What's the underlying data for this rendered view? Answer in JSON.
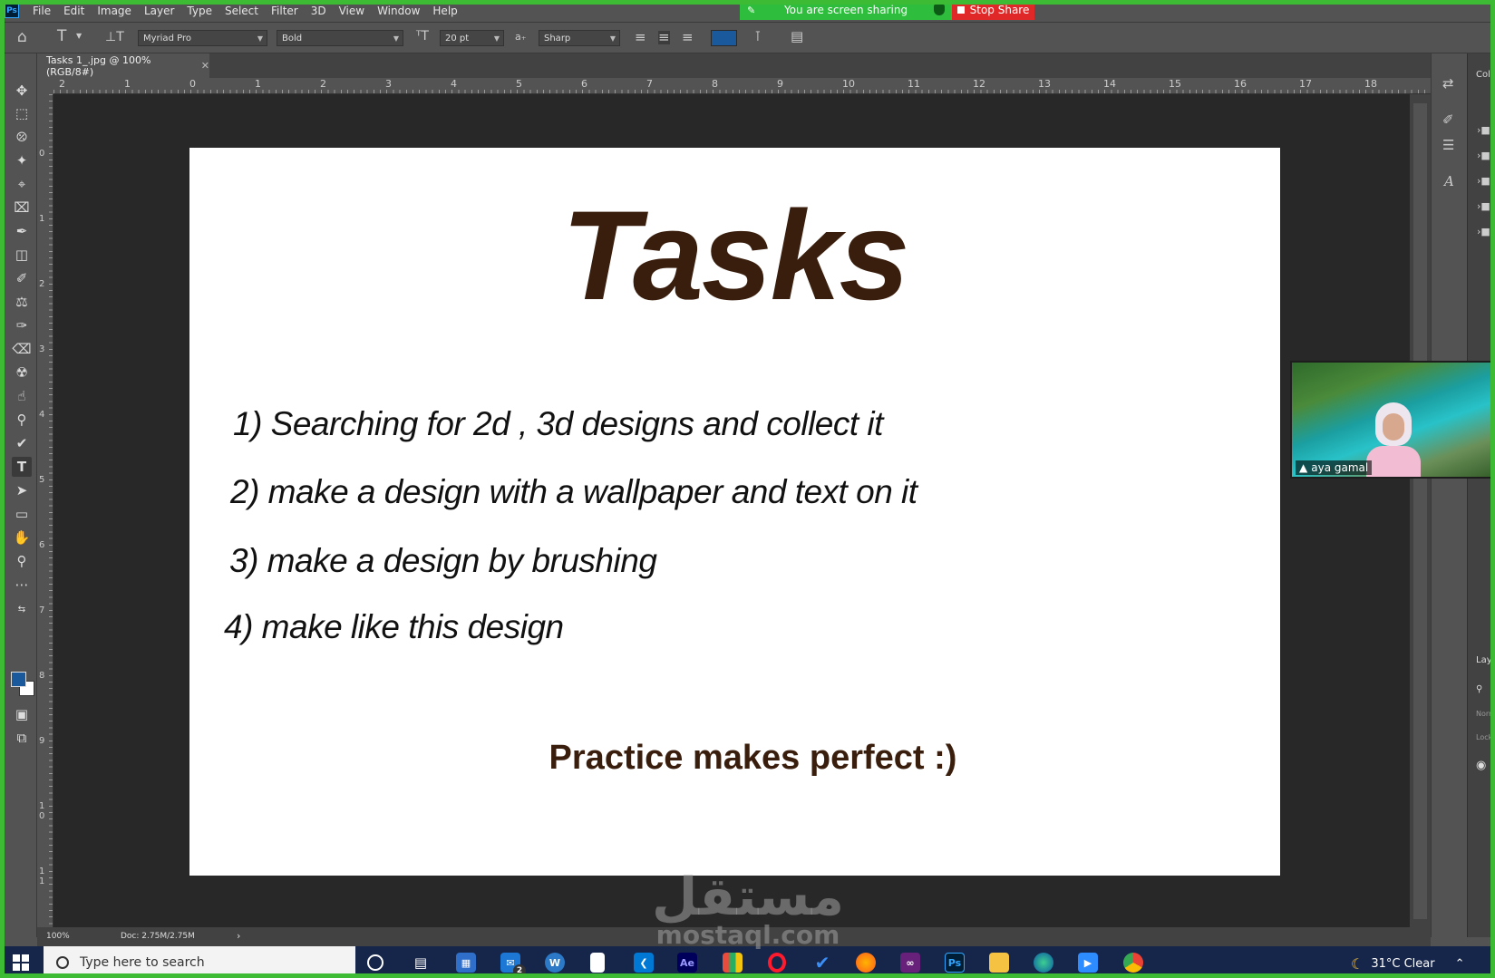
{
  "app": {
    "logo": "Ps"
  },
  "menu": [
    "File",
    "Edit",
    "Image",
    "Layer",
    "Type",
    "Select",
    "Filter",
    "3D",
    "View",
    "Window",
    "Help"
  ],
  "share": {
    "status": "You are screen sharing",
    "stop_label": "Stop Share",
    "status_color": "#2ebd3c",
    "stop_color": "#e02828"
  },
  "options": {
    "font_family": "Myriad Pro",
    "font_style": "Bold",
    "font_size": "20 pt",
    "antialias": "Sharp",
    "text_color": "#1a5a9c",
    "font_size_icon": "font-size-icon",
    "antialias_icon": "aa-icon"
  },
  "document": {
    "tab_title": "Tasks 1_.jpg @ 100% (RGB/8#)",
    "zoom": "100%",
    "doc_size": "Doc: 2.75M/2.75M"
  },
  "rulers": {
    "top": [
      "2",
      "1",
      "0",
      "1",
      "2",
      "3",
      "4",
      "5",
      "6",
      "7",
      "8",
      "9",
      "10",
      "11",
      "12",
      "13",
      "14",
      "15",
      "16",
      "17",
      "18"
    ],
    "left": [
      "0",
      "1",
      "2",
      "3",
      "4",
      "5",
      "6",
      "7",
      "8",
      "9",
      "1\n0",
      "1\n1"
    ]
  },
  "canvas": {
    "title": "Tasks",
    "tasks": [
      "1) Searching for 2d , 3d designs and collect it",
      "2) make a design with a wallpaper and text on it",
      "3) make a design by brushing",
      "4) make like this design"
    ],
    "footer": "Practice makes perfect :)",
    "text_color": "#3a1e0d"
  },
  "panels": {
    "color_label": "Colo",
    "layers_label": "Laye",
    "blend_mode": "Norr",
    "lock_label": "Lock:"
  },
  "video": {
    "participant": "aya gamal"
  },
  "watermark": {
    "arabic": "مستقل",
    "latin": "mostaql.com"
  },
  "taskbar": {
    "search_placeholder": "Type here to search",
    "mail_badge": "2",
    "weather": "31°C  Clear",
    "apps": [
      "cortana",
      "task-view",
      "store",
      "mail",
      "app-w",
      "file",
      "vscode",
      "after-effects",
      "office",
      "opera",
      "todo",
      "firefox",
      "visual-studio",
      "photoshop",
      "explorer",
      "edge",
      "zoom",
      "chrome"
    ]
  }
}
